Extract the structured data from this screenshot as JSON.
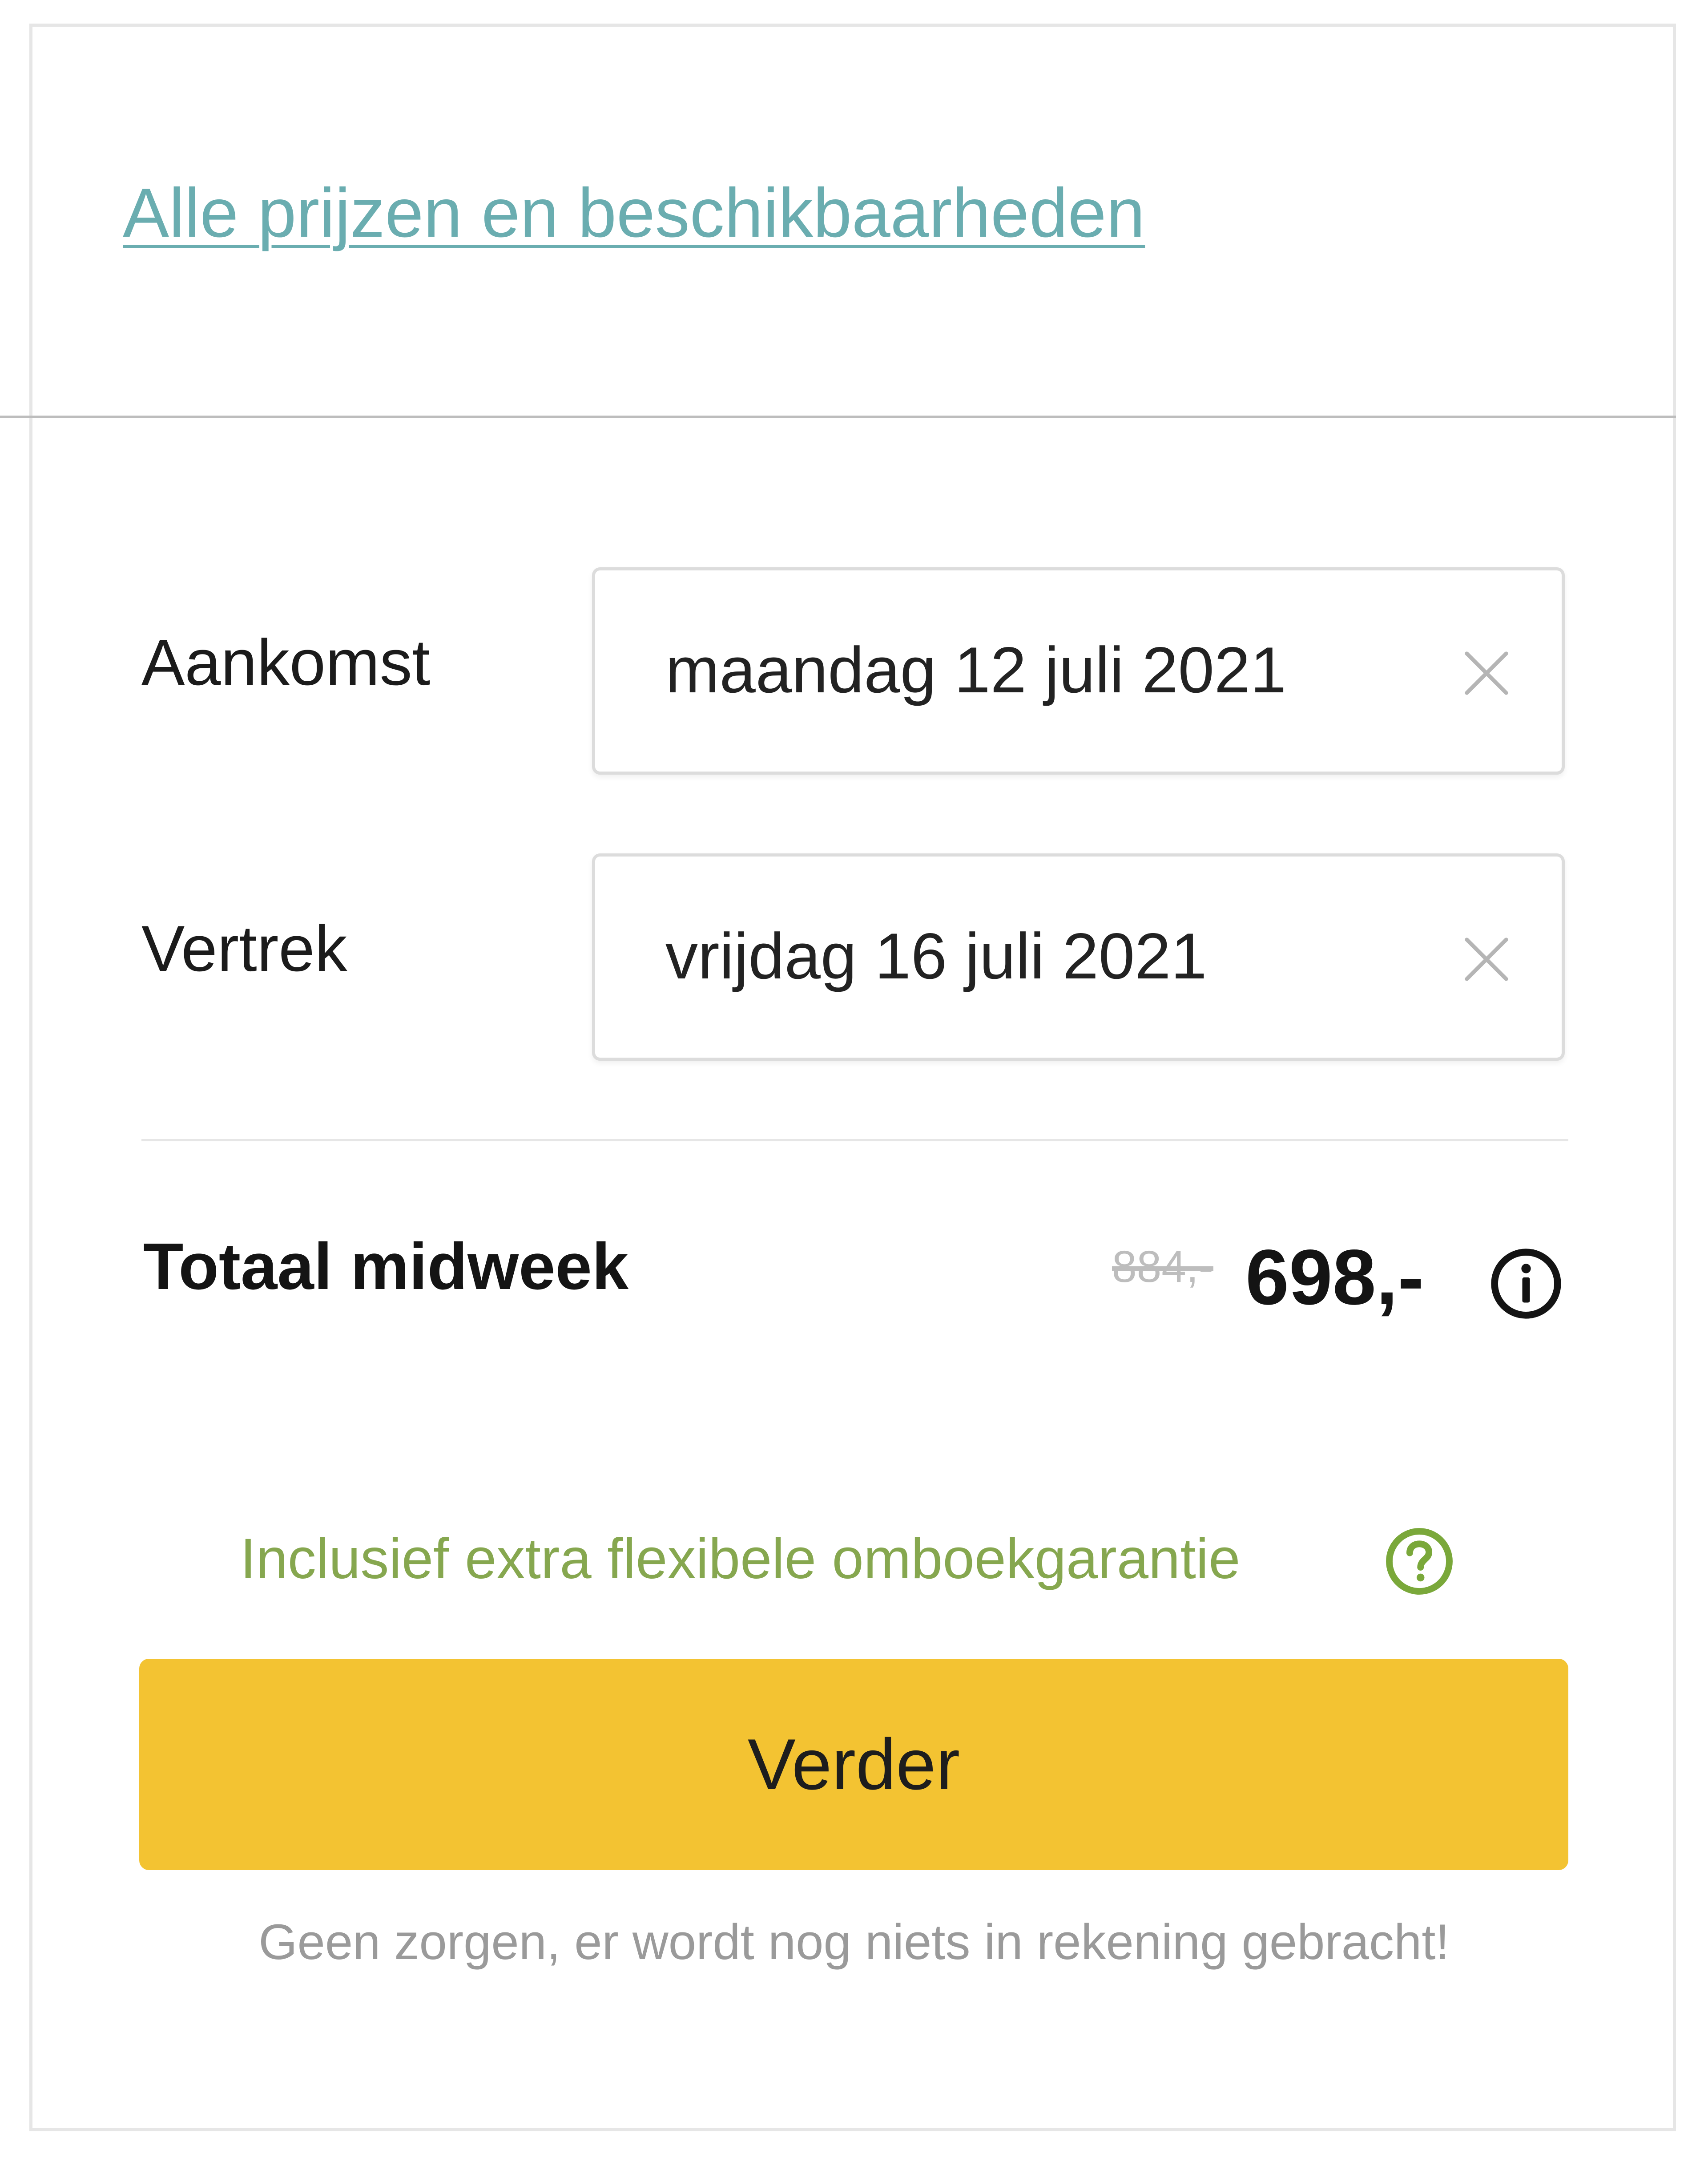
{
  "booking": {
    "all_prices_link": "Alle prijzen en beschikbaarheden",
    "arrival": {
      "label": "Aankomst",
      "value": "maandag 12 juli 2021",
      "clear_icon": "close-icon"
    },
    "departure": {
      "label": "Vertrek",
      "value": "vrijdag 16 juli 2021",
      "clear_icon": "close-icon"
    },
    "total": {
      "label": "Totaal midweek",
      "original_price": "884,-",
      "price": "698,-",
      "info_icon": "info-icon"
    },
    "guarantee": {
      "text": "Inclusief extra flexibele omboekgarantie",
      "help_icon": "question-circle-icon"
    },
    "continue_label": "Verder",
    "footnote": "Geen zorgen, er wordt nog niets in rekening gebracht!"
  },
  "colors": {
    "link": "#6aadb0",
    "accent_button": "#f3c332",
    "guarantee": "#86a74f",
    "text": "#1b1b1b",
    "muted": "#9a9a9a"
  }
}
